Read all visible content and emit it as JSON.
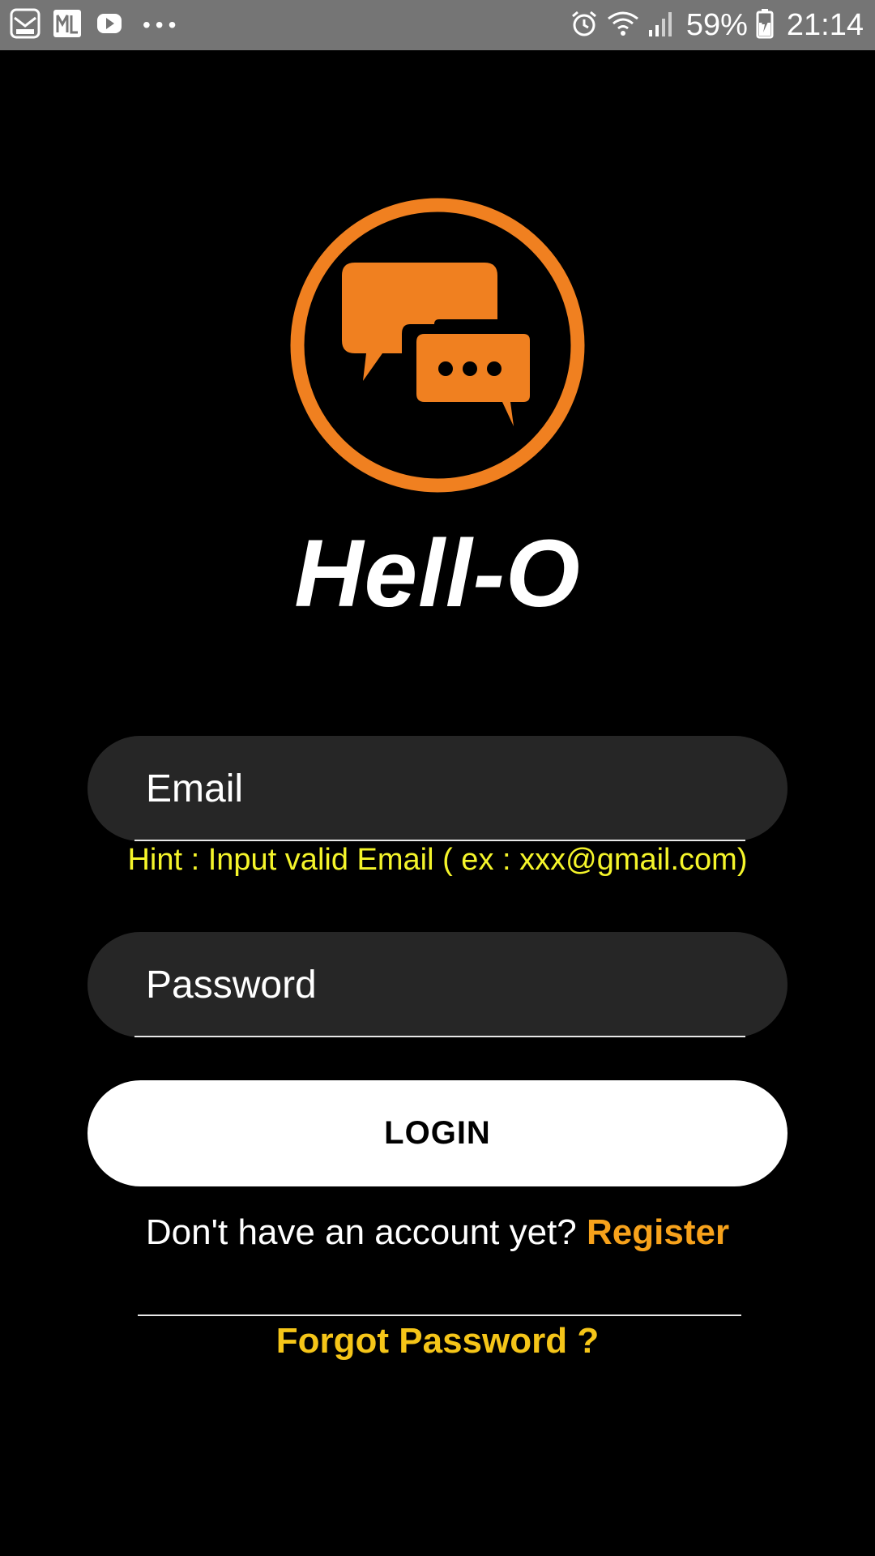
{
  "status_bar": {
    "notification_icons": [
      "real-drum-icon",
      "ml-app-icon",
      "media-play-icon",
      "more-notifications-icon"
    ],
    "system_icons": [
      "alarm-icon",
      "wifi-icon",
      "signal-icon",
      "battery-charging-icon"
    ],
    "battery_percent": "59%",
    "time": "21:14"
  },
  "logo": {
    "icon": "chat-bubbles-icon",
    "color": "#f08020"
  },
  "app_title": "Hell-O",
  "form": {
    "email_placeholder": "Email",
    "email_hint": "Hint : Input valid Email ( ex : xxx@gmail.com)",
    "password_placeholder": "Password",
    "login_label": "LOGIN"
  },
  "footer": {
    "register_prompt": "Don't have an account yet? ",
    "register_label": "Register",
    "forgot_password_label": "Forgot Password ?"
  },
  "colors": {
    "background": "#000000",
    "accent_orange": "#f08020",
    "register_orange": "#f7a21b",
    "hint_yellow": "#f5f52a",
    "forgot_yellow": "#f5c518"
  }
}
